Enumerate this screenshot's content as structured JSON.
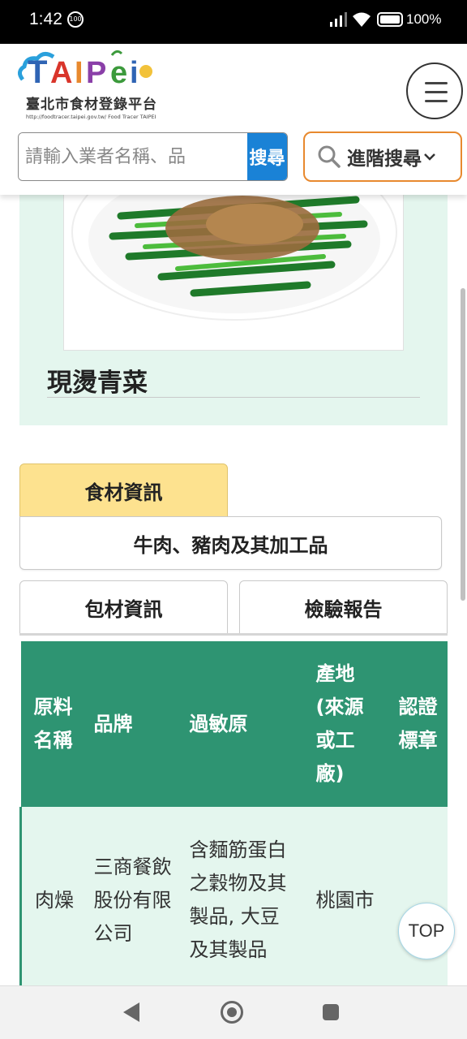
{
  "status_bar": {
    "time": "1:42",
    "notification_badge": "100",
    "battery_pct": "100%"
  },
  "header": {
    "logo": {
      "brand": "TAIPEI",
      "subtitle": "臺北市食材登錄平台",
      "url": "http://foodtracer.taipei.gov.tw/  Food Tracer TAIPEI"
    },
    "search": {
      "placeholder": "請輸入業者名稱、品",
      "button": "搜尋"
    },
    "advanced_search": "進階搜尋"
  },
  "dish": {
    "name": "現燙青菜"
  },
  "tabs": {
    "food_info": "食材資訊",
    "category": "牛肉、豬肉及其加工品",
    "package_info": "包材資訊",
    "inspection_report": "檢驗報告"
  },
  "table": {
    "headers": [
      "原料名稱",
      "品牌",
      "過敏原",
      "產地(來源或工廠)",
      "認證標章"
    ],
    "rows": [
      [
        "肉燥",
        "三商餐飲股份有限公司",
        "含麵筋蛋白之穀物及其製品, 大豆及其製品",
        "桃園市",
        ""
      ]
    ]
  },
  "top_button": "TOP",
  "colors": {
    "accent_green": "#2e9472",
    "light_green": "#e4f6ee",
    "tab_yellow": "#fde28f",
    "search_blue": "#1a82d6",
    "adv_orange": "#e8892e"
  }
}
